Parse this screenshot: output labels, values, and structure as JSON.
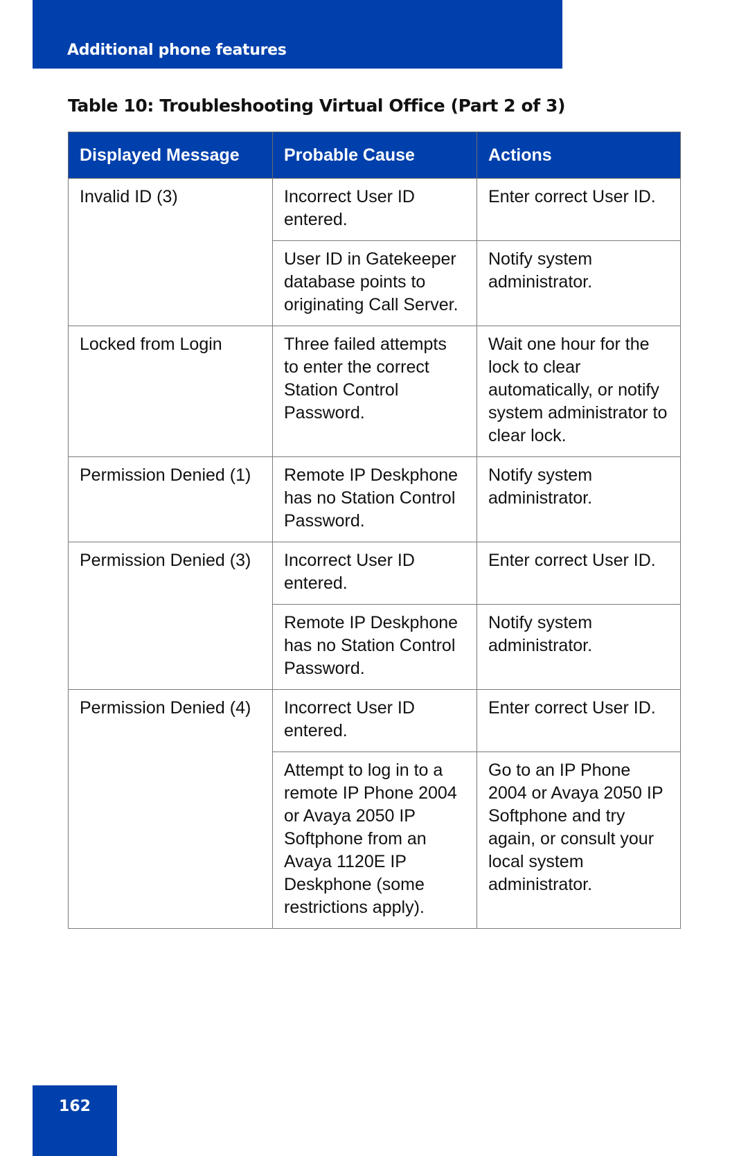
{
  "header": {
    "section_title": "Additional phone features"
  },
  "table": {
    "caption": "Table 10: Troubleshooting Virtual Office (Part 2 of 3)",
    "columns": [
      "Displayed Message",
      "Probable Cause",
      "Actions"
    ],
    "rows": [
      {
        "message": "Invalid ID (3)",
        "entries": [
          {
            "cause": "Incorrect User ID entered.",
            "action": "Enter correct User ID."
          },
          {
            "cause": "User ID in Gatekeeper database points to originating Call Server.",
            "action": "Notify system administrator."
          }
        ]
      },
      {
        "message": "Locked from Login",
        "entries": [
          {
            "cause": "Three failed attempts to enter the correct Station Control Password.",
            "action": "Wait one hour for the lock to clear automatically, or notify system administrator to clear lock."
          }
        ]
      },
      {
        "message": "Permission Denied (1)",
        "entries": [
          {
            "cause": "Remote IP Deskphone has no Station Control Password.",
            "action": "Notify system administrator."
          }
        ]
      },
      {
        "message": "Permission Denied (3)",
        "entries": [
          {
            "cause": "Incorrect User ID entered.",
            "action": "Enter correct User ID."
          },
          {
            "cause": "Remote IP Deskphone has no Station Control Password.",
            "action": "Notify system administrator."
          }
        ]
      },
      {
        "message": "Permission Denied (4)",
        "entries": [
          {
            "cause": "Incorrect User ID entered.",
            "action": "Enter correct User ID."
          },
          {
            "cause": "Attempt to log in to a remote IP Phone 2004 or Avaya 2050 IP Softphone from an Avaya 1120E IP Deskphone (some restrictions apply).",
            "action": "Go to an IP Phone 2004 or Avaya 2050 IP Softphone and try again, or consult your local system administrator."
          }
        ]
      }
    ]
  },
  "footer": {
    "page_number": "162"
  },
  "colors": {
    "brand_blue": "#0040ac",
    "header_text": "#ffffff",
    "border": "#7a7a7a"
  }
}
